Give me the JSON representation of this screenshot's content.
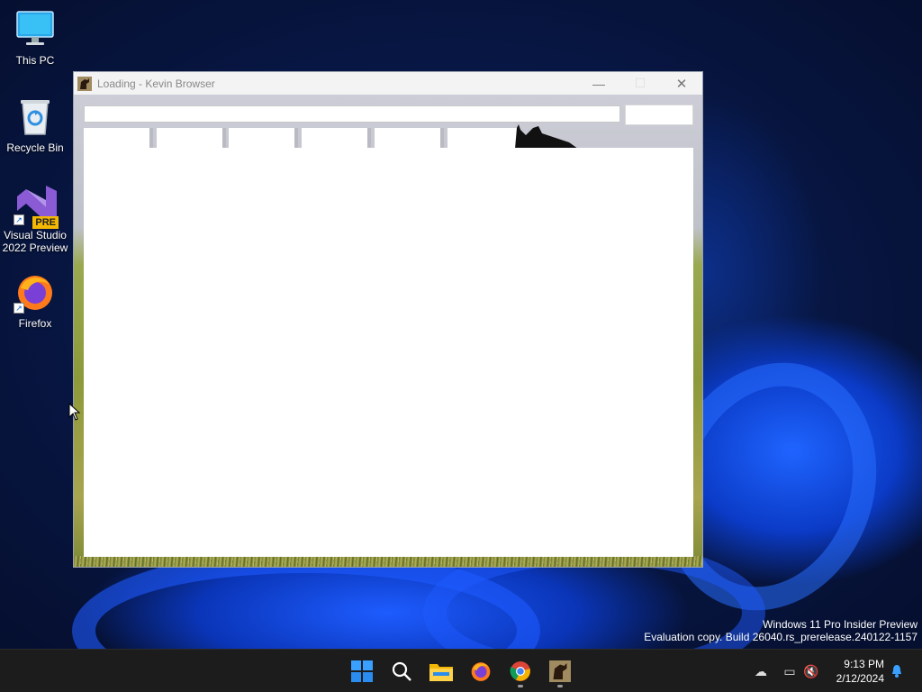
{
  "desktop": {
    "icons": [
      {
        "label": "This PC",
        "icon": "monitor-icon"
      },
      {
        "label": "Recycle Bin",
        "icon": "recycle-bin-icon"
      },
      {
        "label": "Visual Studio\n2022 Preview",
        "icon": "visual-studio-icon",
        "badge": "PRE"
      },
      {
        "label": "Firefox",
        "icon": "firefox-icon"
      }
    ],
    "watermark": {
      "line1": "Windows 11 Pro Insider Preview",
      "line2": "Evaluation copy. Build 26040.rs_prerelease.240122-1157"
    }
  },
  "window": {
    "title": "Loading - Kevin Browser",
    "controls": {
      "minimize": "—",
      "maximize": "☐",
      "close": "✕"
    },
    "address_value": "",
    "tab_count": 6
  },
  "taskbar": {
    "apps": [
      {
        "name": "start-button",
        "icon": "windows-logo-icon"
      },
      {
        "name": "search-button",
        "icon": "search-icon"
      },
      {
        "name": "file-explorer",
        "icon": "folder-icon"
      },
      {
        "name": "firefox",
        "icon": "firefox-icon"
      },
      {
        "name": "chrome",
        "icon": "chrome-icon"
      },
      {
        "name": "kevin-browser",
        "icon": "horse-icon"
      }
    ],
    "clock": {
      "time": "9:13 PM",
      "date": "2/12/2024"
    }
  },
  "colors": {
    "accent": "#0078d4",
    "taskbar": "#1c1c1c",
    "titlebar": "#f3f3f3"
  }
}
